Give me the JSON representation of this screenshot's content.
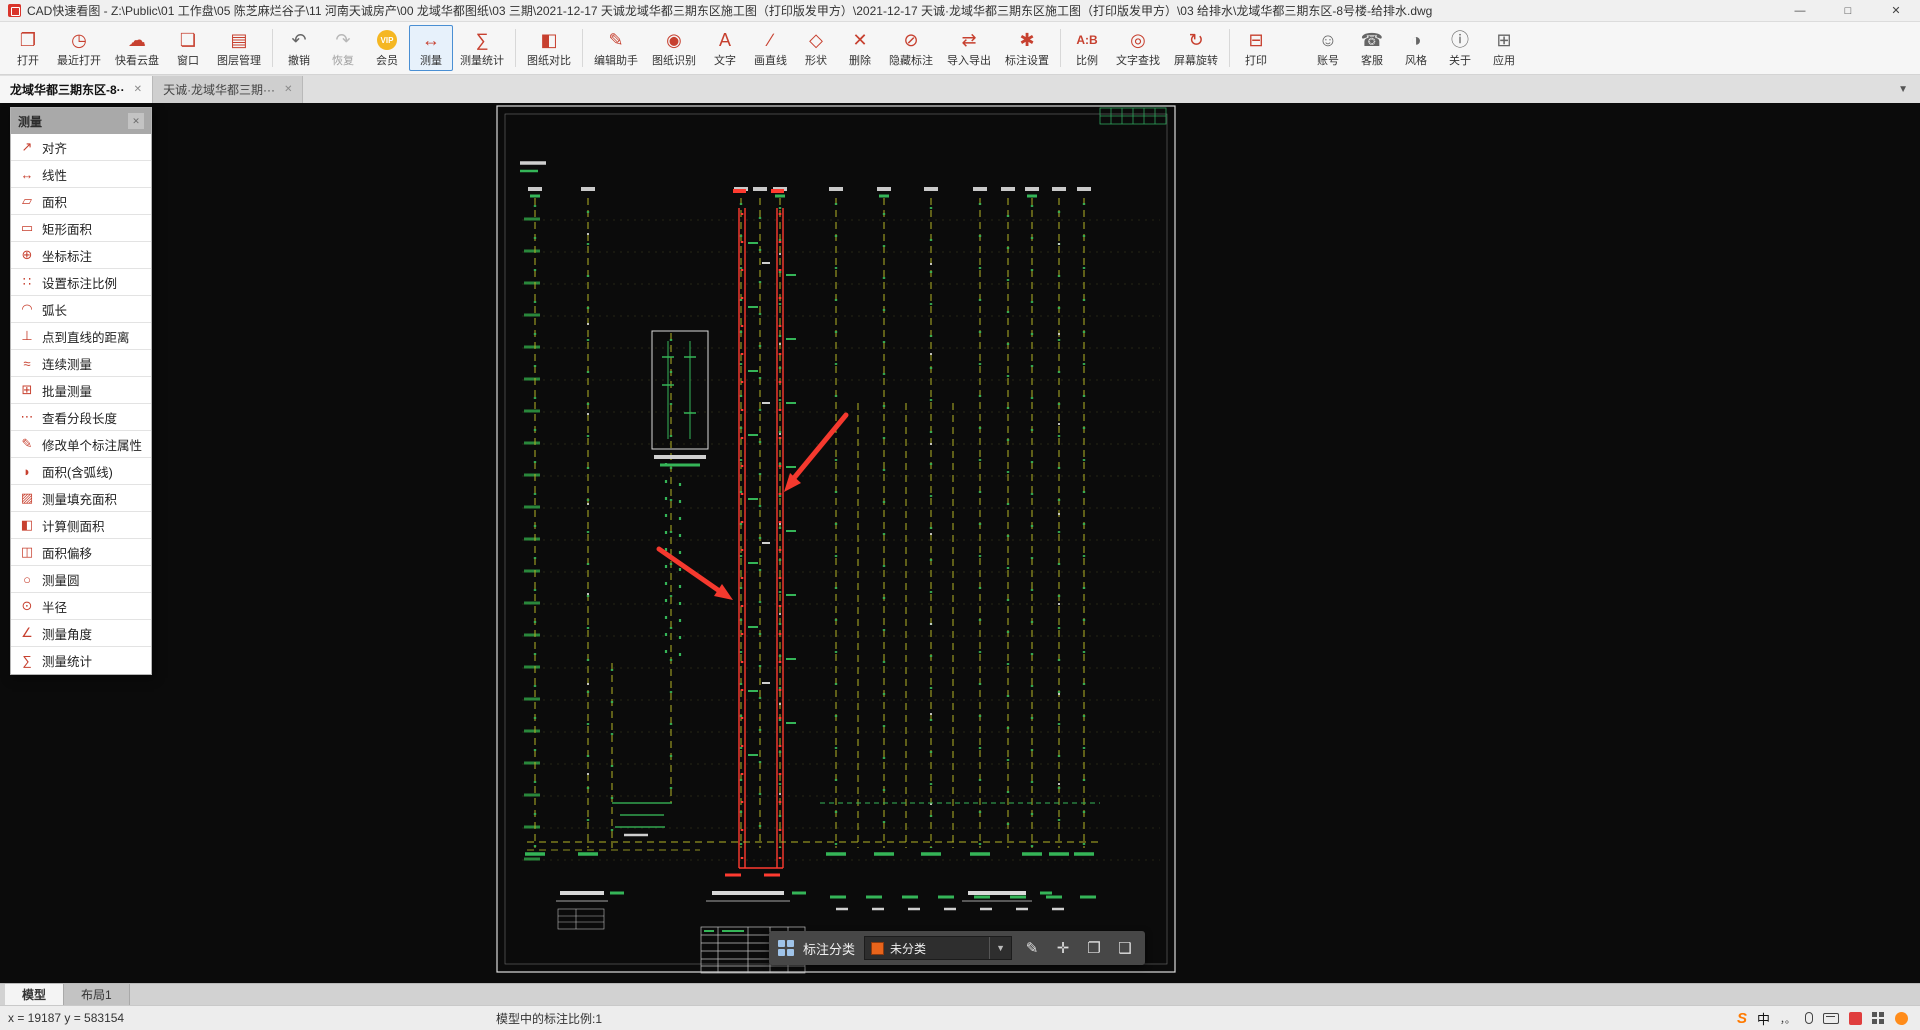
{
  "titlebar": {
    "app_title": "CAD快速看图 - Z:\\Public\\01 工作盘\\05 陈芝麻烂谷子\\11 河南天诚房产\\00 龙域华都图纸\\03 三期\\2021-12-17 天诚龙域华都三期东区施工图（打印版发甲方）\\2021-12-17 天诚·龙域华都三期东区施工图（打印版发甲方）\\03 给排水\\龙域华都三期东区-8号楼-给排水.dwg",
    "minimize": "—",
    "maximize": "□",
    "close": "✕"
  },
  "toolbar": {
    "items": [
      {
        "name": "open",
        "label": "打开",
        "icon": "❐"
      },
      {
        "name": "recent",
        "label": "最近打开",
        "icon": "◷"
      },
      {
        "name": "cloud",
        "label": "快看云盘",
        "icon": "☁"
      },
      {
        "name": "window",
        "label": "窗口",
        "icon": "❏"
      },
      {
        "name": "layers",
        "label": "图层管理",
        "icon": "▤"
      },
      {
        "name": "undo",
        "label": "撤销",
        "icon": "↶"
      },
      {
        "name": "redo",
        "label": "恢复",
        "icon": "↷"
      },
      {
        "name": "vip",
        "label": "会员",
        "icon": "VIP"
      },
      {
        "name": "measure",
        "label": "测量",
        "icon": "↔"
      },
      {
        "name": "measure-stats",
        "label": "测量统计",
        "icon": "∑"
      },
      {
        "name": "compare",
        "label": "图纸对比",
        "icon": "◧"
      },
      {
        "name": "edit-assistant",
        "label": "编辑助手",
        "icon": "✎"
      },
      {
        "name": "recognize",
        "label": "图纸识别",
        "icon": "◉"
      },
      {
        "name": "text",
        "label": "文字",
        "icon": "A"
      },
      {
        "name": "line",
        "label": "画直线",
        "icon": "∕"
      },
      {
        "name": "shape",
        "label": "形状",
        "icon": "◇"
      },
      {
        "name": "delete",
        "label": "删除",
        "icon": "✕"
      },
      {
        "name": "hide-annotation",
        "label": "隐藏标注",
        "icon": "⊘"
      },
      {
        "name": "import-export",
        "label": "导入导出",
        "icon": "⇄"
      },
      {
        "name": "annotation-settings",
        "label": "标注设置",
        "icon": "✱"
      },
      {
        "name": "scale",
        "label": "比例",
        "icon": "A:B"
      },
      {
        "name": "find-text",
        "label": "文字查找",
        "icon": "◎"
      },
      {
        "name": "rotate-screen",
        "label": "屏幕旋转",
        "icon": "↻"
      },
      {
        "name": "print",
        "label": "打印",
        "icon": "⊟"
      },
      {
        "name": "account",
        "label": "账号",
        "icon": "☺"
      },
      {
        "name": "support",
        "label": "客服",
        "icon": "☎"
      },
      {
        "name": "style",
        "label": "风格",
        "icon": "◑"
      },
      {
        "name": "about",
        "label": "关于",
        "icon": "ⓘ"
      },
      {
        "name": "apps",
        "label": "应用",
        "icon": "⊞"
      }
    ]
  },
  "tabbar": {
    "overflow_arrow": "▼",
    "tabs": [
      {
        "label": "龙域华都三期东区-8··",
        "close": "✕"
      },
      {
        "label": "天诚·龙域华都三期···",
        "close": "✕"
      }
    ]
  },
  "measure_panel": {
    "title": "测量",
    "close": "✕",
    "items": [
      {
        "label": "对齐",
        "icon": "↗"
      },
      {
        "label": "线性",
        "icon": "↔"
      },
      {
        "label": "面积",
        "icon": "▱"
      },
      {
        "label": "矩形面积",
        "icon": "▭"
      },
      {
        "label": "坐标标注",
        "icon": "⊕"
      },
      {
        "label": "设置标注比例",
        "icon": "∷"
      },
      {
        "label": "弧长",
        "icon": "◠"
      },
      {
        "label": "点到直线的距离",
        "icon": "⊥"
      },
      {
        "label": "连续测量",
        "icon": "≈"
      },
      {
        "label": "批量测量",
        "icon": "⊞"
      },
      {
        "label": "查看分段长度",
        "icon": "⋯"
      },
      {
        "label": "修改单个标注属性",
        "icon": "✎"
      },
      {
        "label": "面积(含弧线)",
        "icon": "◗"
      },
      {
        "label": "测量填充面积",
        "icon": "▨"
      },
      {
        "label": "计算侧面积",
        "icon": "◧"
      },
      {
        "label": "面积偏移",
        "icon": "◫"
      },
      {
        "label": "测量圆",
        "icon": "○"
      },
      {
        "label": "半径",
        "icon": "⊙"
      },
      {
        "label": "测量角度",
        "icon": "∠"
      },
      {
        "label": "测量统计",
        "icon": "∑"
      }
    ]
  },
  "annotation_bar": {
    "label": "标注分类",
    "selected": "未分类",
    "swatch_color": "#E8641B",
    "dropdown_arrow": "▼",
    "icons": {
      "edit": "✎",
      "move": "✛",
      "copy": "❐",
      "paste": "❑"
    }
  },
  "bottom_tabs": [
    {
      "label": "模型"
    },
    {
      "label": "布局1"
    }
  ],
  "statusbar": {
    "coordinates": "x = 19187  y = 583154",
    "scale_info": "模型中的标注比例:1"
  },
  "tray": {
    "ime": "S",
    "lang": "中",
    "punct": "，。"
  },
  "colors": {
    "icon_red": "#C7402F",
    "active_border_blue": "#4A8FD3",
    "vip_gold": "#F5B722",
    "category_swatch": "#E8641B",
    "drawing_pipe_yellow": "#B3B326",
    "drawing_fitting_green": "#35B558",
    "drawing_highlight_red": "#FF3B30",
    "paper_border_white": "#DCDCDC",
    "canvas_black": "#0B0B0B"
  }
}
